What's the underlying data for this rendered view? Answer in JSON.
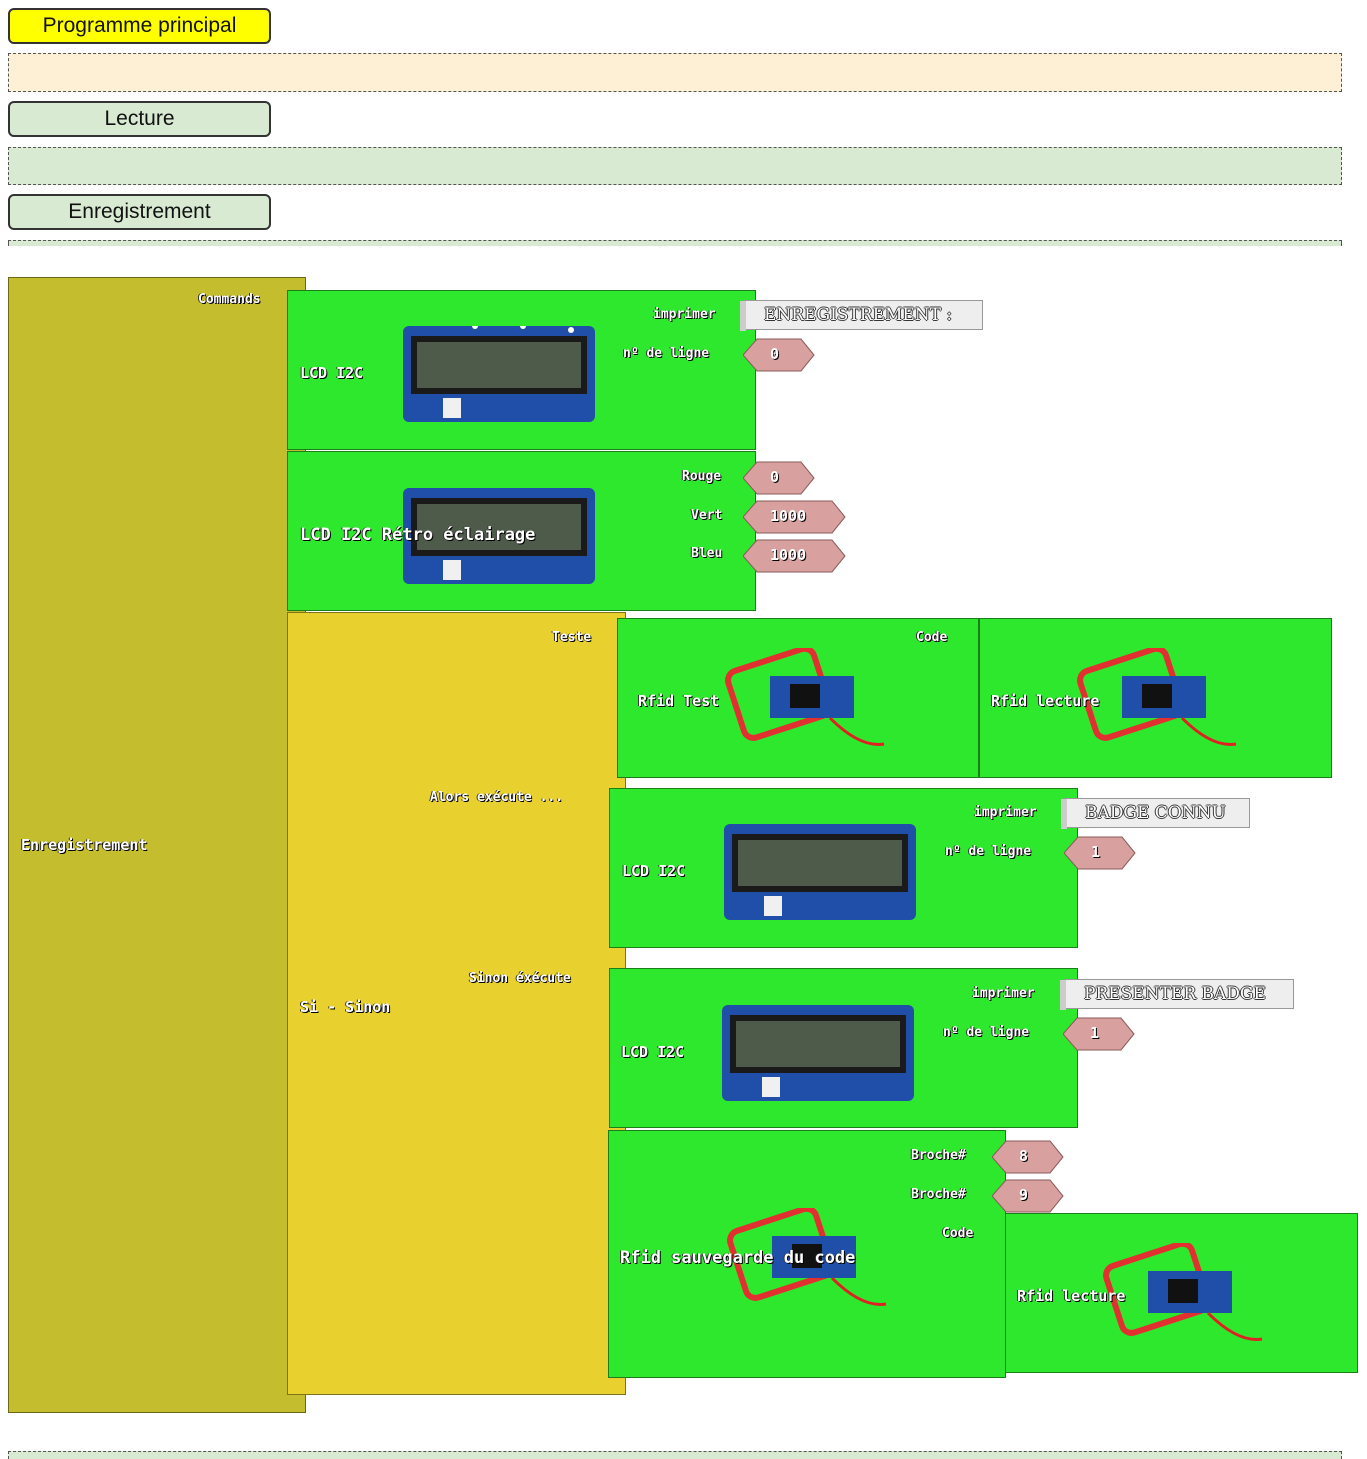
{
  "tabs": [
    {
      "label": "Programme principal",
      "bg": "#ffff00"
    },
    {
      "label": "Lecture",
      "bg": "#d9ead3"
    },
    {
      "label": "Enregistrement",
      "bg": "#d9ead3"
    }
  ],
  "colors": {
    "green": "#2ee82e",
    "olive": "#c4bd2e",
    "yellow": "#e8d12e",
    "number": "#d9a0a0"
  },
  "function_block": {
    "label": "Enregistrement",
    "slot": "Commands"
  },
  "lcd1": {
    "label": "LCD I2C",
    "print": "imprimer",
    "text": "ENREGISTREMENT :",
    "line_label": "nº de ligne",
    "line": "0"
  },
  "backlight": {
    "label": "LCD I2C Rétro éclairage",
    "red_label": "Rouge",
    "red": "0",
    "green_label": "Vert",
    "green": "1000",
    "blue_label": "Bleu",
    "blue": "1000"
  },
  "ifelse": {
    "label": "Si - Sinon",
    "test": "Teste",
    "then": "Alors exécute ...",
    "else": "Sinon éxécute"
  },
  "rfid_test": {
    "label": "Rfid Test",
    "code": "Code"
  },
  "rfid_read1": {
    "label": "Rfid lecture"
  },
  "lcd2": {
    "label": "LCD I2C",
    "print": "imprimer",
    "text": "BADGE CONNU",
    "line_label": "nº de ligne",
    "line": "1"
  },
  "lcd3": {
    "label": "LCD I2C",
    "print": "imprimer",
    "text": "PRESENTER BADGE",
    "line_label": "nº de ligne",
    "line": "1"
  },
  "rfid_save": {
    "label": "Rfid sauvegarde du code",
    "pin_label_1": "Broche#",
    "pin1": "8",
    "pin_label_2": "Broche#",
    "pin2": "9",
    "code": "Code"
  },
  "rfid_read2": {
    "label": "Rfid lecture"
  }
}
